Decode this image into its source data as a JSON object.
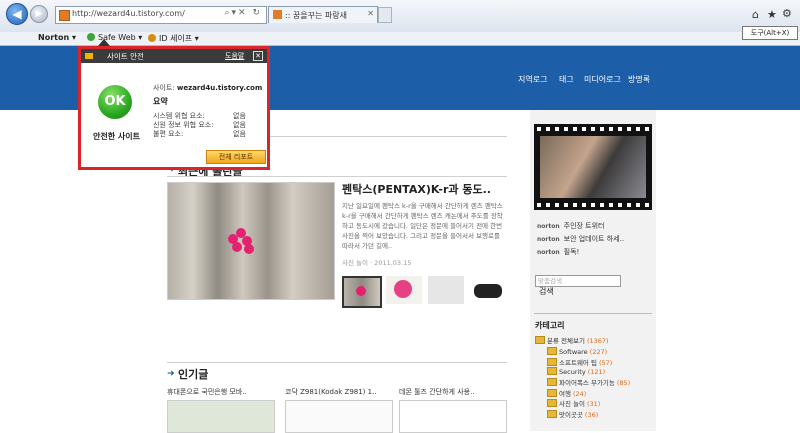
{
  "browser": {
    "url": "http://wezard4u.tistory.com/",
    "tab_label": ":: 꿈을꾸는 파랑새",
    "tooltip": "도구(Alt+X)",
    "norton_label": "Norton",
    "safe_web_label": "Safe Web",
    "id_safe_label": "ID 세이프"
  },
  "norton_popup": {
    "title": "사이트 안전",
    "help_label": "도움말",
    "ok_text": "OK",
    "status_label": "안전한 사이트",
    "site_prefix": "사이트:",
    "site_value": "wezard4u.tistory.com",
    "summary_label": "요약",
    "risks": [
      {
        "label": "시스템 위협 요소:",
        "value": "없음"
      },
      {
        "label": "신원 정보 위협 요소:",
        "value": "없음"
      },
      {
        "label": "불편 요소:",
        "value": "없음"
      }
    ],
    "full_report_label": "전체 리포트"
  },
  "site_nav": [
    "지역로그",
    "태그",
    "미디어로그",
    "방명록"
  ],
  "main": {
    "section1_title": "최근에 올린글",
    "post_title": "펜탁스(PENTAX)K-r과 동도..",
    "post_excerpt": "지난 일요일에 펜탁스 k-r을 구매해서 간단하게 렌즈 펜탁스 k-r을 구매해서 간단하게 펜탁스 렌즈 캐논에서 추도를 장착하고 동도시에 갔습니다. 일단은 정문에 들어서기 전에 한번 사진을 찍어 보았습니다. 그리고 정문을 들어서서 보행로를 따라서 가던 길에..",
    "post_date": "사진 놀이 · 2011.03.15",
    "section2_title": "인기글",
    "popular": [
      "휴대폰으로 국민은행 모바..",
      "코닥 Z981(Kodak Z981) 1..",
      "데몬 툴즈 간단하게 사용.."
    ]
  },
  "sidebar": {
    "news": [
      {
        "tag": "norton",
        "text": "주인장 트위터"
      },
      {
        "tag": "norton",
        "text": "보안 업데이트 하세.."
      },
      {
        "tag": "norton",
        "text": "필독!"
      }
    ],
    "search_placeholder": "맞춤검색",
    "search_button": "검색",
    "category_title": "카테고리",
    "categories": [
      {
        "name": "분류 전체보기",
        "count": "(1367)"
      },
      {
        "name": "Software",
        "count": "(227)"
      },
      {
        "name": "소프트웨어 팁",
        "count": "(57)"
      },
      {
        "name": "Security",
        "count": "(121)"
      },
      {
        "name": "파이어폭스 부가기능",
        "count": "(85)"
      },
      {
        "name": "여행",
        "count": "(24)"
      },
      {
        "name": "사진 놀이",
        "count": "(31)"
      },
      {
        "name": "맛이곳곳",
        "count": "(36)"
      }
    ]
  }
}
